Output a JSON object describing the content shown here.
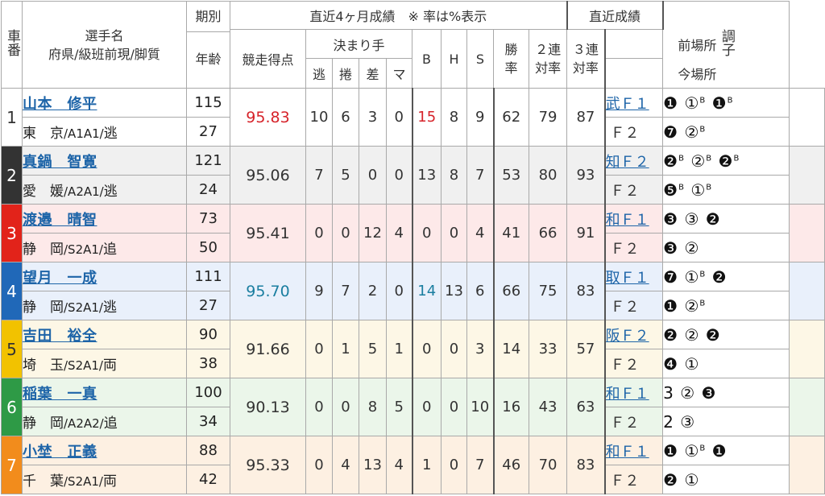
{
  "header": {
    "car_no": "車番",
    "racer": "選手名",
    "racer_sub": "府県/級班前現/脚質",
    "period": "期別",
    "age": "年齢",
    "recent4": "直近4ヶ月成績　※ 率は%表示",
    "score": "競走得点",
    "kimarite": "決まり手",
    "k_nige": "逃",
    "k_makuri": "捲",
    "k_sashi": "差",
    "k_mark": "マ",
    "b": "B",
    "h": "H",
    "s": "S",
    "win_rate": "勝率",
    "ren2": "２連対率",
    "ren3": "３連対率",
    "recent": "直近成績",
    "prev_venue": "前場所",
    "cur_venue": "今場所",
    "condition": "調子"
  },
  "colors": {
    "car1": "#ffffff",
    "car2": "#333333",
    "car3": "#e2231a",
    "car4": "#2068b8",
    "car5": "#f2c200",
    "car6": "#2e9a46",
    "car7": "#f28c1c",
    "row1": "#ffffff",
    "row2": "#f0f0f0",
    "row3": "#fde9e9",
    "row4": "#e9f0fb",
    "row5": "#fdf7e6",
    "row6": "#ebf6ea",
    "row7": "#fdf0e2"
  },
  "racers": [
    {
      "car": "1",
      "name": "山本　修平",
      "pref": "東　京",
      "grade": "/A1A1/",
      "style": "逃",
      "period": "115",
      "age": "27",
      "score": "95.83",
      "nige": "10",
      "makuri": "6",
      "sashi": "3",
      "mark": "0",
      "b": "15",
      "h": "8",
      "s": "9",
      "win": "62",
      "ren2": "79",
      "ren3": "87",
      "prev_venue": "武",
      "prev_f": "Ｆ１",
      "prev_marks": [
        "❶",
        "①",
        "❶"
      ],
      "prev_sup": [
        "",
        "B",
        "B"
      ],
      "cur_f": "Ｆ２",
      "cur_marks": [
        "❼",
        "②",
        ""
      ],
      "cur_sup": [
        "",
        "B",
        ""
      ]
    },
    {
      "car": "2",
      "name": "真鍋　智寛",
      "pref": "愛　媛",
      "grade": "/A2A1/",
      "style": "逃",
      "period": "121",
      "age": "24",
      "score": "95.06",
      "nige": "7",
      "makuri": "5",
      "sashi": "0",
      "mark": "0",
      "b": "13",
      "h": "8",
      "s": "7",
      "win": "53",
      "ren2": "80",
      "ren3": "93",
      "prev_venue": "知",
      "prev_f": "Ｆ２",
      "prev_marks": [
        "❷",
        "②",
        "❷"
      ],
      "prev_sup": [
        "B",
        "B",
        "B"
      ],
      "cur_f": "Ｆ２",
      "cur_marks": [
        "❺",
        "①",
        ""
      ],
      "cur_sup": [
        "B",
        "B",
        ""
      ]
    },
    {
      "car": "3",
      "name": "渡邉　晴智",
      "pref": "静　岡",
      "grade": "/S2A1/",
      "style": "追",
      "period": "73",
      "age": "50",
      "score": "95.41",
      "nige": "0",
      "makuri": "0",
      "sashi": "12",
      "mark": "4",
      "b": "0",
      "h": "0",
      "s": "4",
      "win": "41",
      "ren2": "66",
      "ren3": "91",
      "prev_venue": "和",
      "prev_f": "Ｆ１",
      "prev_marks": [
        "❸",
        "③",
        "❷"
      ],
      "prev_sup": [
        "",
        "",
        ""
      ],
      "cur_f": "Ｆ２",
      "cur_marks": [
        "❸",
        "②",
        ""
      ],
      "cur_sup": [
        "",
        "",
        ""
      ]
    },
    {
      "car": "4",
      "name": "望月　一成",
      "pref": "静　岡",
      "grade": "/S2A1/",
      "style": "逃",
      "period": "111",
      "age": "27",
      "score": "95.70",
      "nige": "9",
      "makuri": "7",
      "sashi": "2",
      "mark": "0",
      "b": "14",
      "h": "13",
      "s": "6",
      "win": "66",
      "ren2": "75",
      "ren3": "83",
      "prev_venue": "取",
      "prev_f": "Ｆ１",
      "prev_marks": [
        "❼",
        "①",
        "❷"
      ],
      "prev_sup": [
        "",
        "B",
        ""
      ],
      "cur_f": "Ｆ２",
      "cur_marks": [
        "❶",
        "②",
        ""
      ],
      "cur_sup": [
        "",
        "B",
        ""
      ]
    },
    {
      "car": "5",
      "name": "吉田　裕全",
      "pref": "埼　玉",
      "grade": "/S2A1/",
      "style": "両",
      "period": "90",
      "age": "38",
      "score": "91.66",
      "nige": "0",
      "makuri": "1",
      "sashi": "5",
      "mark": "1",
      "b": "0",
      "h": "0",
      "s": "3",
      "win": "14",
      "ren2": "33",
      "ren3": "57",
      "prev_venue": "阪",
      "prev_f": "Ｆ２",
      "prev_marks": [
        "❷",
        "②",
        "❷"
      ],
      "prev_sup": [
        "",
        "",
        ""
      ],
      "cur_f": "Ｆ２",
      "cur_marks": [
        "❹",
        "①",
        ""
      ],
      "cur_sup": [
        "",
        "",
        ""
      ]
    },
    {
      "car": "6",
      "name": "稲葉　一真",
      "pref": "静　岡",
      "grade": "/A2A2/",
      "style": "追",
      "period": "100",
      "age": "34",
      "score": "90.13",
      "nige": "0",
      "makuri": "0",
      "sashi": "8",
      "mark": "5",
      "b": "0",
      "h": "0",
      "s": "10",
      "win": "16",
      "ren2": "43",
      "ren3": "63",
      "prev_venue": "和",
      "prev_f": "Ｆ１",
      "prev_marks": [
        "3",
        "②",
        "❸"
      ],
      "prev_sup": [
        "",
        "",
        ""
      ],
      "cur_f": "Ｆ２",
      "cur_marks": [
        "2",
        "③",
        ""
      ],
      "cur_sup": [
        "",
        "",
        ""
      ]
    },
    {
      "car": "7",
      "name": "小埜　正義",
      "pref": "千　葉",
      "grade": "/S2A1/",
      "style": "両",
      "period": "88",
      "age": "42",
      "score": "95.33",
      "nige": "0",
      "makuri": "4",
      "sashi": "13",
      "mark": "4",
      "b": "1",
      "h": "0",
      "s": "7",
      "win": "46",
      "ren2": "70",
      "ren3": "83",
      "prev_venue": "和",
      "prev_f": "Ｆ１",
      "prev_marks": [
        "❶",
        "①",
        "❶"
      ],
      "prev_sup": [
        "",
        "B",
        ""
      ],
      "cur_f": "Ｆ２",
      "cur_marks": [
        "❷",
        "①",
        ""
      ],
      "cur_sup": [
        "",
        "",
        ""
      ]
    }
  ],
  "highlights": {
    "score_red": "1",
    "score_blue": "4",
    "b_red": "1",
    "b_blue": "4"
  }
}
